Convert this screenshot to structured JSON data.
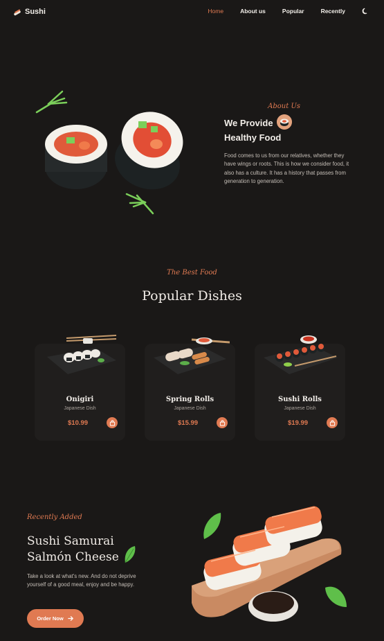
{
  "header": {
    "logo_text": "Sushi",
    "nav": [
      {
        "label": "Home",
        "active": true
      },
      {
        "label": "About us",
        "active": false
      },
      {
        "label": "Popular",
        "active": false
      },
      {
        "label": "Recently",
        "active": false
      }
    ],
    "theme_icon": "moon-icon"
  },
  "about": {
    "eyebrow": "About Us",
    "title_line1": "We Provide",
    "title_line2": "Healthy Food",
    "description": "Food comes to us from our relatives, whether they have wings or roots. This is how we consider food, it also has a culture. It has a history that passes from generation to generation."
  },
  "popular": {
    "eyebrow": "The Best Food",
    "title": "Popular Dishes",
    "dishes": [
      {
        "name": "Onigiri",
        "subtitle": "Japanese Dish",
        "price": "$10.99"
      },
      {
        "name": "Spring Rolls",
        "subtitle": "Japanese Dish",
        "price": "$15.99"
      },
      {
        "name": "Sushi Rolls",
        "subtitle": "Japanese Dish",
        "price": "$19.99"
      }
    ]
  },
  "recent": {
    "eyebrow": "Recently Added",
    "title_line1": "Sushi Samurai",
    "title_line2": "Salmón Cheese",
    "description": "Take a look at what's new. And do not deprive yourself of a good meal, enjoy and be happy.",
    "button_label": "Order Now"
  },
  "colors": {
    "background": "#1a1817",
    "accent": "#e07a52",
    "card": "#201e1d"
  }
}
